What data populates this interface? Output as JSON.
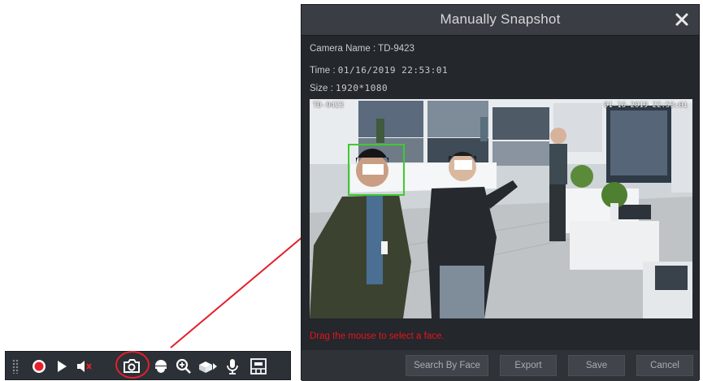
{
  "dialog": {
    "title": "Manually Snapshot",
    "camera_name_label": "Camera Name :",
    "camera_name_value": "TD-9423",
    "time_label": "Time :",
    "time_value": "01/16/2019 22:53:01",
    "size_label": "Size :",
    "size_value": "1920*1080",
    "osd_left": "TD-9423",
    "osd_right": "01-16-2019 22:53:01",
    "hint": "Drag the mouse to select a face.",
    "buttons": {
      "search_by_face": "Search By Face",
      "export": "Export",
      "save": "Save",
      "cancel": "Cancel"
    }
  },
  "toolbar": {
    "icons": [
      "grip-icon",
      "record-icon",
      "play-icon",
      "mute-icon",
      "snapshot-camera-icon",
      "ptz-dome-icon",
      "zoom-icon",
      "3d-icon",
      "microphone-icon",
      "fisheye-icon"
    ]
  },
  "colors": {
    "highlight": "#e4202b",
    "face_box": "#3dcb2e",
    "hint": "#e6141e"
  }
}
